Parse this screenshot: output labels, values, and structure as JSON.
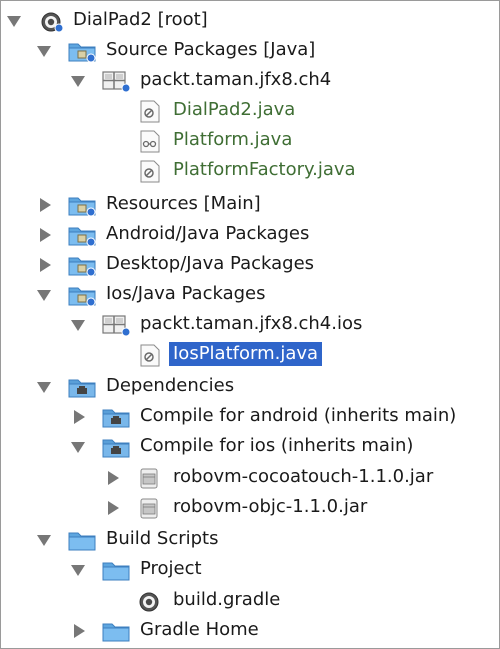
{
  "tree": {
    "root": {
      "label": "DialPad2 [root]",
      "icon": "gradle-project-icon"
    },
    "source_packages": {
      "label": "Source Packages [Java]",
      "package": {
        "label": "packt.taman.jfx8.ch4",
        "files": [
          "DialPad2.java",
          "Platform.java",
          "PlatformFactory.java"
        ]
      }
    },
    "resources": {
      "label": "Resources [Main]"
    },
    "android_packages": {
      "label": "Android/Java Packages"
    },
    "desktop_packages": {
      "label": "Desktop/Java Packages"
    },
    "ios_packages": {
      "label": "Ios/Java Packages",
      "package": {
        "label": "packt.taman.jfx8.ch4.ios",
        "file": "IosPlatform.java"
      }
    },
    "dependencies": {
      "label": "Dependencies",
      "compile_android": {
        "label": "Compile for android (inherits main)"
      },
      "compile_ios": {
        "label": "Compile for ios (inherits main)",
        "jars": [
          "robovm-cocoatouch-1.1.0.jar",
          "robovm-objc-1.1.0.jar"
        ]
      }
    },
    "build_scripts": {
      "label": "Build Scripts",
      "project": {
        "label": "Project",
        "file": "build.gradle"
      },
      "gradle_home": {
        "label": "Gradle Home"
      }
    }
  },
  "colors": {
    "selection": "#2f65ca",
    "java_file_text": "#3f6e34",
    "folder_blue": "#5fa8e3"
  }
}
